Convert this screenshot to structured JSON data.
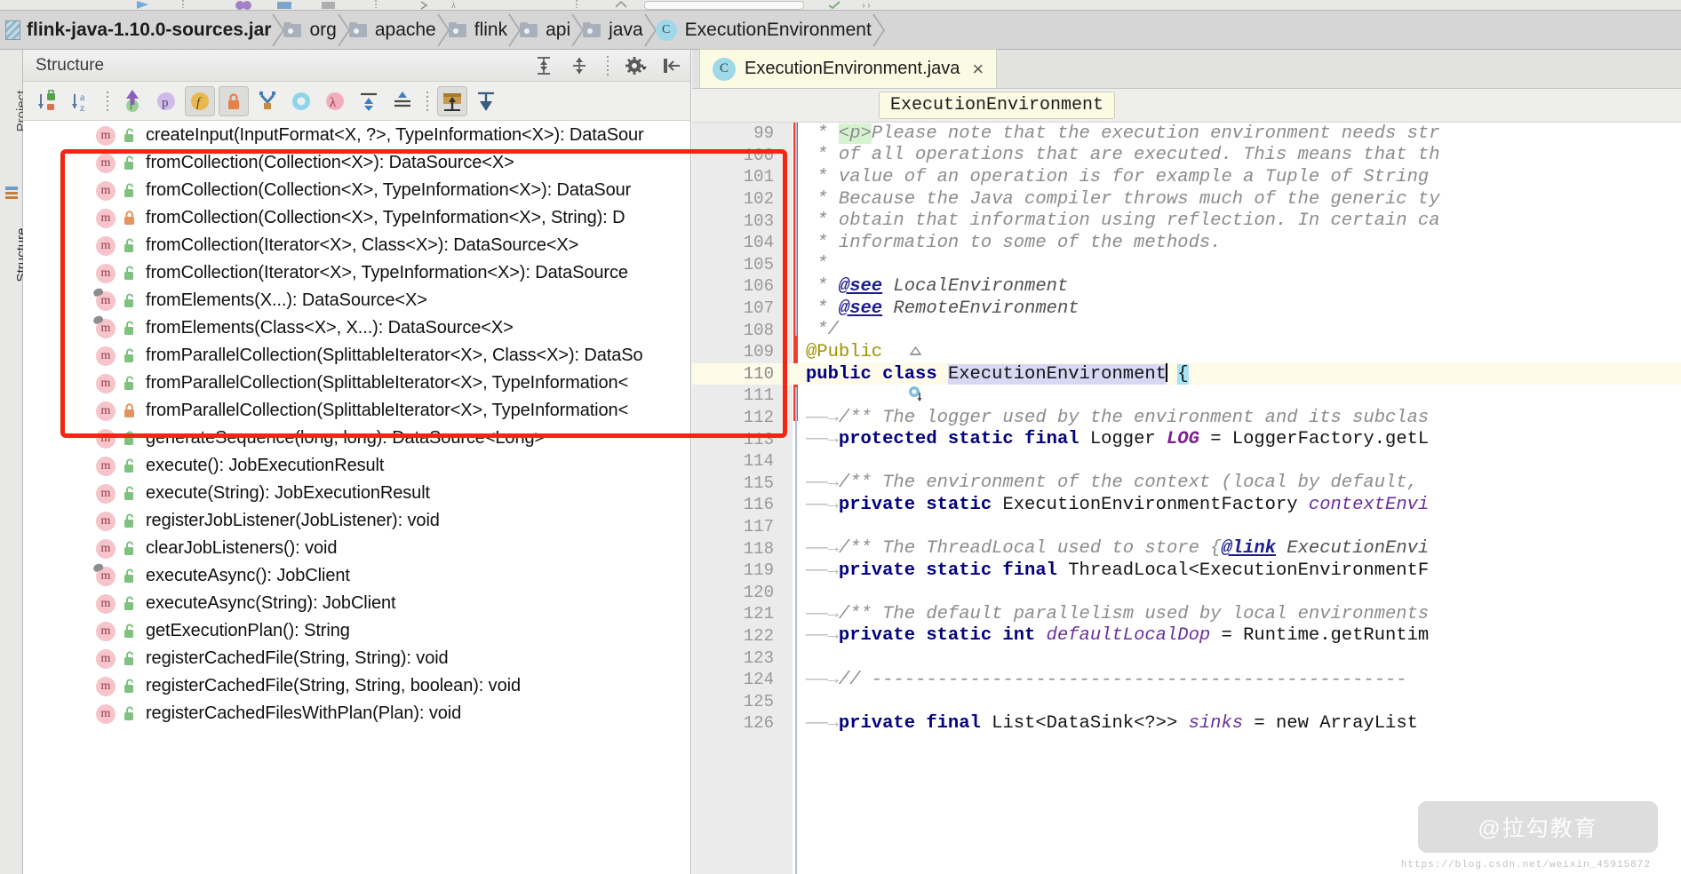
{
  "breadcrumb": {
    "items": [
      {
        "label": "flink-java-1.10.0-sources.jar",
        "icon": "jar-icon",
        "kind": "jar"
      },
      {
        "label": "org",
        "icon": "folder-icon",
        "kind": "folder"
      },
      {
        "label": "apache",
        "icon": "folder-icon",
        "kind": "folder"
      },
      {
        "label": "flink",
        "icon": "folder-icon",
        "kind": "folder"
      },
      {
        "label": "api",
        "icon": "folder-icon",
        "kind": "folder"
      },
      {
        "label": "java",
        "icon": "folder-icon",
        "kind": "folder"
      },
      {
        "label": "ExecutionEnvironment",
        "icon": "class-icon",
        "kind": "class",
        "glyph": "C"
      }
    ]
  },
  "left_strip": {
    "tabs": [
      {
        "label": "Project"
      },
      {
        "label": "Structure"
      }
    ]
  },
  "structure": {
    "title": "Structure",
    "header_actions": [
      {
        "name": "expand-all-icon",
        "label": "Expand All"
      },
      {
        "name": "collapse-all-icon",
        "label": "Collapse All"
      },
      {
        "name": "settings-gear-icon",
        "label": "Settings"
      },
      {
        "name": "hide-panel-icon",
        "label": "Hide"
      }
    ],
    "toolbar": [
      {
        "name": "sort-by-visibility-icon",
        "toggled": false
      },
      {
        "name": "sort-alphabetically-icon",
        "toggled": false
      },
      {
        "name": "show-inherited-icon",
        "toggled": false
      },
      {
        "name": "show-properties-icon",
        "toggled": false
      },
      {
        "name": "show-fields-icon",
        "toggled": true
      },
      {
        "name": "show-non-public-icon",
        "toggled": true
      },
      {
        "name": "show-anonymous-classes-icon",
        "toggled": false
      },
      {
        "name": "show-interfaces-icon",
        "toggled": false
      },
      {
        "name": "show-lambdas-icon",
        "toggled": false
      },
      {
        "name": "expand-all-tree-icon",
        "toggled": false
      },
      {
        "name": "collapse-all-tree-icon",
        "toggled": false
      },
      {
        "name": "autoscroll-to-source-icon",
        "toggled": true
      },
      {
        "name": "autoscroll-from-source-icon",
        "toggled": false
      }
    ],
    "tree_items": [
      {
        "label": "createInput(InputFormat<X, ?>, TypeInformation<X>): DataSour",
        "visibility": "public",
        "inherited": false
      },
      {
        "label": "fromCollection(Collection<X>): DataSource<X>",
        "visibility": "public",
        "inherited": false
      },
      {
        "label": "fromCollection(Collection<X>, TypeInformation<X>): DataSour",
        "visibility": "public",
        "inherited": false
      },
      {
        "label": "fromCollection(Collection<X>, TypeInformation<X>, String): D",
        "visibility": "private",
        "inherited": false
      },
      {
        "label": "fromCollection(Iterator<X>, Class<X>): DataSource<X>",
        "visibility": "public",
        "inherited": false
      },
      {
        "label": "fromCollection(Iterator<X>, TypeInformation<X>): DataSource",
        "visibility": "public",
        "inherited": false
      },
      {
        "label": "fromElements(X...): DataSource<X>",
        "visibility": "public",
        "inherited": true
      },
      {
        "label": "fromElements(Class<X>, X...): DataSource<X>",
        "visibility": "public",
        "inherited": true
      },
      {
        "label": "fromParallelCollection(SplittableIterator<X>, Class<X>): DataSo",
        "visibility": "public",
        "inherited": false
      },
      {
        "label": "fromParallelCollection(SplittableIterator<X>, TypeInformation<",
        "visibility": "public",
        "inherited": false
      },
      {
        "label": "fromParallelCollection(SplittableIterator<X>, TypeInformation<",
        "visibility": "private",
        "inherited": false
      },
      {
        "label": "generateSequence(long, long): DataSource<Long>",
        "visibility": "public",
        "inherited": false
      },
      {
        "label": "execute(): JobExecutionResult",
        "visibility": "public",
        "inherited": false
      },
      {
        "label": "execute(String): JobExecutionResult",
        "visibility": "public",
        "inherited": false
      },
      {
        "label": "registerJobListener(JobListener): void",
        "visibility": "public",
        "inherited": false
      },
      {
        "label": "clearJobListeners(): void",
        "visibility": "public",
        "inherited": false
      },
      {
        "label": "executeAsync(): JobClient",
        "visibility": "public",
        "inherited": true
      },
      {
        "label": "executeAsync(String): JobClient",
        "visibility": "public",
        "inherited": false
      },
      {
        "label": "getExecutionPlan(): String",
        "visibility": "public",
        "inherited": false
      },
      {
        "label": "registerCachedFile(String, String): void",
        "visibility": "public",
        "inherited": false
      },
      {
        "label": "registerCachedFile(String, String, boolean): void",
        "visibility": "public",
        "inherited": false
      },
      {
        "label": "registerCachedFilesWithPlan(Plan): void",
        "visibility": "public",
        "inherited": false
      }
    ]
  },
  "editor": {
    "tab": {
      "title": "ExecutionEnvironment.java",
      "glyph": "C",
      "close": "×"
    },
    "context_chip": "ExecutionEnvironment",
    "lines": [
      {
        "num": "99",
        "kind": "javadoc",
        "current": false
      },
      {
        "num": "100",
        "kind": "javadoc",
        "current": false
      },
      {
        "num": "101",
        "kind": "javadoc",
        "current": false
      },
      {
        "num": "102",
        "kind": "javadoc",
        "current": false
      },
      {
        "num": "103",
        "kind": "javadoc",
        "current": false
      },
      {
        "num": "104",
        "kind": "javadoc",
        "current": false
      },
      {
        "num": "105",
        "kind": "javadoc",
        "current": false
      },
      {
        "num": "106",
        "kind": "javadoc",
        "current": false
      },
      {
        "num": "107",
        "kind": "javadoc",
        "current": false
      },
      {
        "num": "108",
        "kind": "javadoc",
        "current": false
      },
      {
        "num": "109",
        "kind": "annotation",
        "current": false
      },
      {
        "num": "110",
        "kind": "class-decl",
        "current": true
      },
      {
        "num": "111",
        "kind": "blank",
        "current": false
      },
      {
        "num": "112",
        "kind": "javadoc",
        "current": false
      },
      {
        "num": "113",
        "kind": "field",
        "current": false
      },
      {
        "num": "114",
        "kind": "blank",
        "current": false
      },
      {
        "num": "115",
        "kind": "javadoc",
        "current": false
      },
      {
        "num": "116",
        "kind": "field",
        "current": false
      },
      {
        "num": "117",
        "kind": "blank",
        "current": false
      },
      {
        "num": "118",
        "kind": "javadoc",
        "current": false
      },
      {
        "num": "119",
        "kind": "field",
        "current": false
      },
      {
        "num": "120",
        "kind": "blank",
        "current": false
      },
      {
        "num": "121",
        "kind": "javadoc",
        "current": false
      },
      {
        "num": "122",
        "kind": "field",
        "current": false
      },
      {
        "num": "123",
        "kind": "blank",
        "current": false
      },
      {
        "num": "124",
        "kind": "comment",
        "current": false
      },
      {
        "num": "125",
        "kind": "blank",
        "current": false
      },
      {
        "num": "126",
        "kind": "field",
        "current": false
      }
    ],
    "code": {
      "l99_a": " * ",
      "l99_tag": "<p>",
      "l99_b": "Please note that the execution environment needs str",
      "l100": " * of all operations that are executed. This means that th",
      "l101": " * value of an operation is for example a Tuple of String",
      "l102": " * Because the Java compiler throws much of the generic ty",
      "l103": " * obtain that information using reflection. In certain ca",
      "l104": " * information to some of the methods.",
      "l105": " *",
      "l106_a": " * ",
      "l106_link": "@see",
      "l106_b": " LocalEnvironment",
      "l107_a": " * ",
      "l107_link": "@see",
      "l107_b": " RemoteEnvironment",
      "l108": " */",
      "l109": "@Public",
      "l110_k1": "public class ",
      "l110_ident": "ExecutionEnvironment",
      "l110_brace": "{",
      "l112": "/** The logger used by the environment and its subclas",
      "l113_k": "protected static final ",
      "l113_t": "Logger ",
      "l113_f": "LOG",
      "l113_r": " = LoggerFactory.getL",
      "l115": "/** The environment of the context (local by default, ",
      "l116_k": "private static ",
      "l116_t": "ExecutionEnvironmentFactory ",
      "l116_f": "contextEnvi",
      "l118_a": "/** The ThreadLocal used to store {",
      "l118_link": "@link",
      "l118_b": " ExecutionEnvi",
      "l119_k": "private static final ",
      "l119_t": "ThreadLocal<ExecutionEnvironmentF",
      "l121": "/** The default parallelism used by local environments",
      "l122_k": "private static int ",
      "l122_f": "defaultLocalDop",
      "l122_r": " = Runtime.getRuntim",
      "l124": "// -------------------------------------------------",
      "l126_k": "private final ",
      "l126_t": "List<DataSink<?>> ",
      "l126_f": "sinks",
      "l126_r": " = new ArrayList"
    }
  },
  "watermark": {
    "text": "@拉勾教育",
    "sub": "https://blog.csdn.net/weixin_45915872"
  },
  "colors": {
    "breadcrumb_bg": "#d6d6d6",
    "panel_bg": "#ffffff",
    "toolbar_bg": "#efefee",
    "tab_active_bg": "#fbfbe4",
    "annotation_red": "#f22613",
    "keyword_blue": "#000082",
    "comment_gray": "#8c8c8c",
    "current_line": "#fdfae7",
    "method_icon": "#f6c4ca",
    "class_icon": "#9fd8e8",
    "modified_mark": "#f03f2e"
  }
}
